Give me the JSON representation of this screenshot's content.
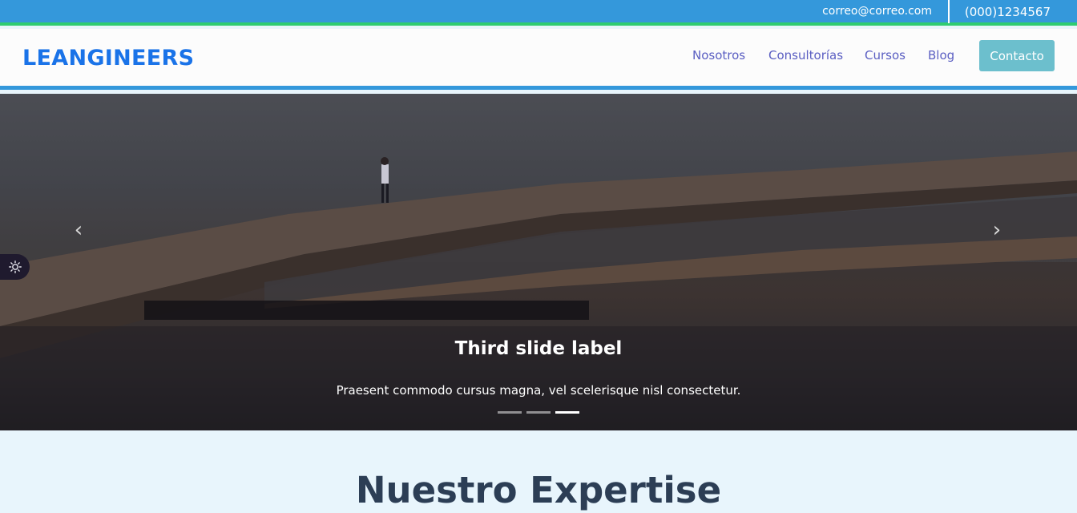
{
  "topbar": {
    "email": "correo@correo.com",
    "phone": "(000)1234567"
  },
  "navbar": {
    "brand": "LEANGINEERS",
    "links": [
      "Nosotros",
      "Consultorías",
      "Cursos",
      "Blog"
    ],
    "contact_button": "Contacto"
  },
  "carousel": {
    "caption_title": "Third slide label",
    "caption_text": "Praesent commodo cursus magna, vel scelerisque nisl consectetur.",
    "prev_icon": "chevron-left-icon",
    "next_icon": "chevron-right-icon",
    "slide_count": 3,
    "active_slide": 3
  },
  "theme_toggle": {
    "icon": "sun-icon"
  },
  "expertise": {
    "title": "Nuestro Expertise"
  },
  "colors": {
    "topbar": "#3498db",
    "topbar_accent": "#2ecc71",
    "brand": "#1a73e8",
    "nav_link": "#5a5ec2",
    "contact_button": "#6cbfcd",
    "section_bg": "#e8f5fc",
    "heading": "#2c3e55"
  }
}
